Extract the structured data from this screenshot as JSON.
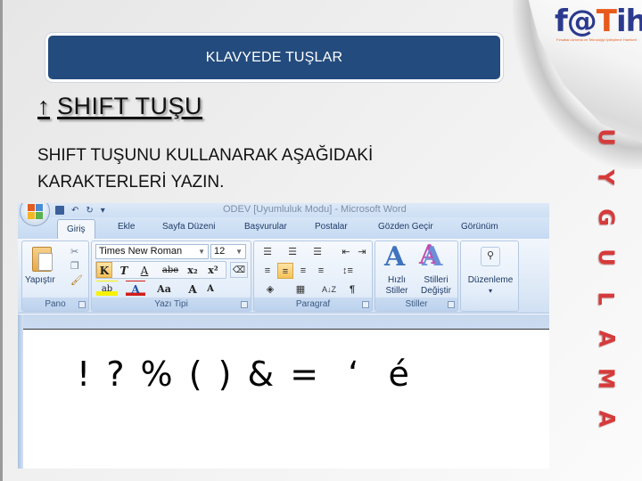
{
  "slide": {
    "title": "KLAVYEDE TUŞLAR",
    "heading_icon": "up-arrow-icon",
    "heading_arrow_glyph": "↑",
    "heading": "SHIFT  TUŞU",
    "instruction_line1": "SHIFT TUŞUNU KULLANARAK AŞAĞIDAKİ",
    "instruction_line2": "KARAKTERLERİ YAZIN.",
    "vertical_label": [
      "U",
      "Y",
      "G",
      "U",
      "L",
      "A",
      "M",
      "A"
    ],
    "accent_color": "#d63a3a",
    "title_bar_color": "#234b7d"
  },
  "logo": {
    "text_f": "f",
    "text_at": "@",
    "text_t": "T",
    "text_ih": "ih",
    "subtitle": "Fırsatları Artırma ve Teknolojiyi İyileştirme Hareketi",
    "brand_color": "#2b3a8f",
    "figure_color": "#e85a1b"
  },
  "word": {
    "window_title": "ODEV [Uyumluluk Modu] - Microsoft Word",
    "tabs": [
      {
        "label": "Giriş",
        "active": true
      },
      {
        "label": "Ekle"
      },
      {
        "label": "Sayfa Düzeni"
      },
      {
        "label": "Başvurular"
      },
      {
        "label": "Postalar"
      },
      {
        "label": "Gözden Geçir"
      },
      {
        "label": "Görünüm"
      }
    ],
    "groups": {
      "pano": {
        "label": "Pano",
        "paste_label": "Yapıştır"
      },
      "font": {
        "label": "Yazı Tipi",
        "font_name": "Times New Roman",
        "font_size": "12",
        "bold": "K",
        "italic": "T",
        "underline": "A",
        "strike": "abe",
        "subscript": "x₂",
        "superscript": "x²",
        "change_case": "Aa",
        "grow": "A",
        "shrink": "A"
      },
      "paragraph": {
        "label": "Paragraf",
        "pilcrow": "¶",
        "sort": "A↓Z"
      },
      "styles": {
        "label": "Stiller",
        "quick_line1": "Hızlı",
        "quick_line2": "Stiller",
        "change_line1": "Stilleri",
        "change_line2": "Değiştir"
      },
      "editing": {
        "label": "Düzenleme"
      }
    },
    "document_text": "! ? % ( ) & =  ‘  é"
  }
}
